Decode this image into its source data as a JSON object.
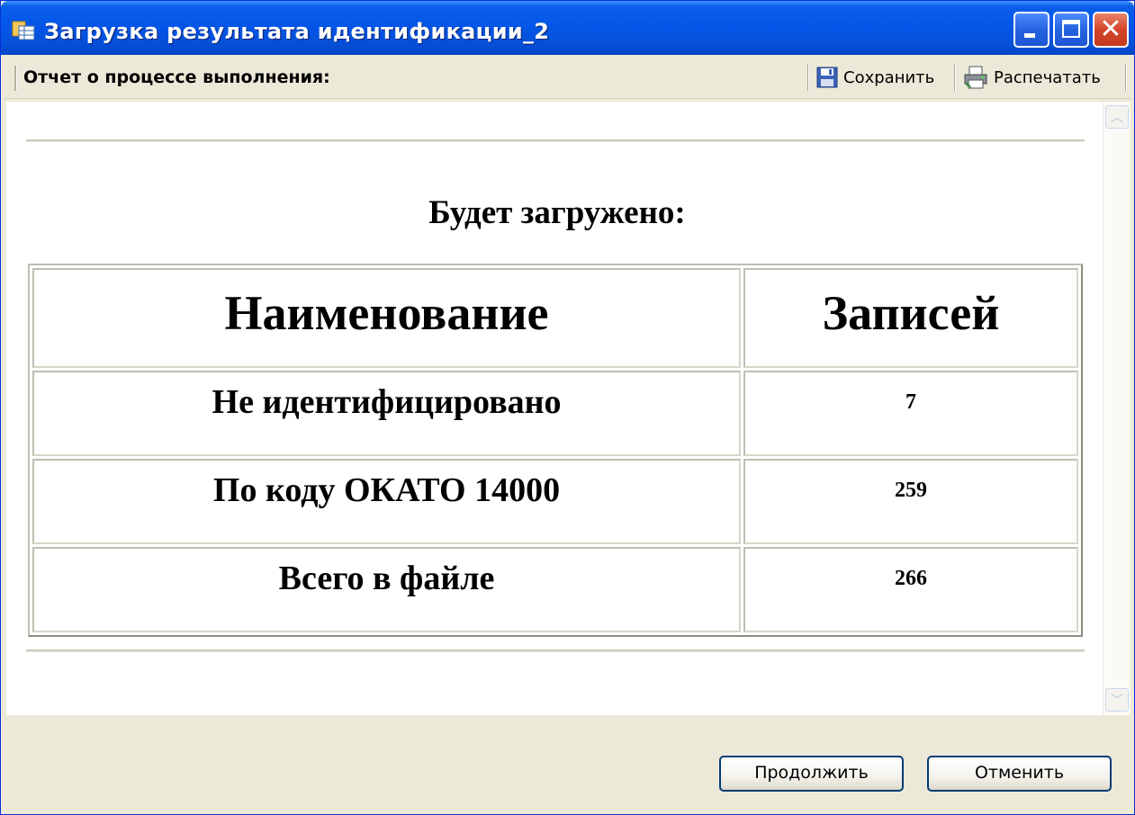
{
  "window": {
    "title": "Загрузка результата идентификации_2"
  },
  "toolbar": {
    "label": "Отчет о процессе выполнения:",
    "save_label": "Сохранить",
    "print_label": "Распечатать"
  },
  "report": {
    "heading": "Будет загружено:",
    "columns": [
      "Наименование",
      "Записей"
    ],
    "rows": [
      {
        "name": "Не идентифицировано",
        "count": "7"
      },
      {
        "name": "По коду ОКАТО 14000",
        "count": "259"
      },
      {
        "name": "Всего в файле",
        "count": "266"
      }
    ]
  },
  "buttons": {
    "continue": "Продолжить",
    "cancel": "Отменить"
  },
  "colors": {
    "titlebar": "#0356e8",
    "close": "#d4452a",
    "dialog_bg": "#ece9d8"
  },
  "icons": {
    "window": "table-icon",
    "save": "floppy-disk-icon",
    "print": "printer-icon"
  }
}
